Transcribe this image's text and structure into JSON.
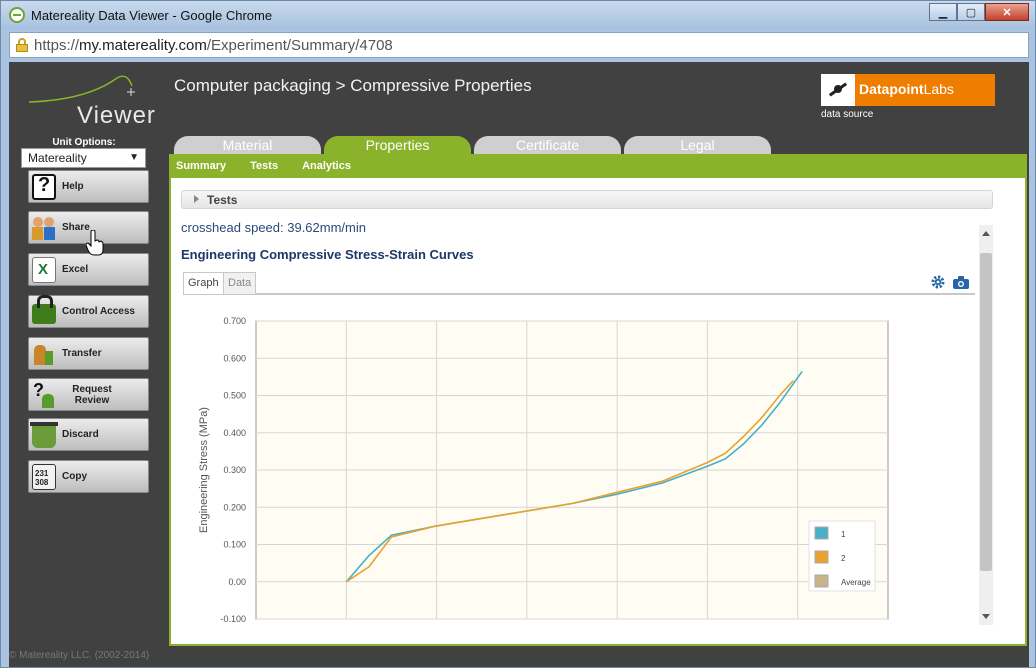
{
  "window": {
    "title": "Matereality Data Viewer - Google Chrome",
    "url_scheme": "https://",
    "url_host": "my.matereality.com",
    "url_path": "/Experiment/Summary/4708"
  },
  "app": {
    "logo_text": "Viewer",
    "breadcrumb": "Computer packaging > Compressive Properties",
    "data_source_name_bold": "Datapoint",
    "data_source_name_rest": "Labs",
    "data_source_caption": "data source",
    "footer": "© Matereality LLC. (2002-2014)"
  },
  "sidebar": {
    "unit_label": "Unit Options:",
    "unit_value": "Matereality",
    "buttons": [
      {
        "label": "Help",
        "icon": "help-icon"
      },
      {
        "label": "Share",
        "icon": "share-icon"
      },
      {
        "label": "Excel",
        "icon": "excel-icon"
      },
      {
        "label": "Control Access",
        "icon": "lock-icon"
      },
      {
        "label": "Transfer",
        "icon": "transfer-icon"
      },
      {
        "label": "Request Review",
        "icon": "request-review-icon"
      },
      {
        "label": "Discard",
        "icon": "discard-icon"
      },
      {
        "label": "Copy",
        "icon": "copy-icon"
      }
    ]
  },
  "tabs": [
    "Material",
    "Properties",
    "Certificate",
    "Legal"
  ],
  "active_tab": "Properties",
  "subnav": [
    "Summary",
    "Tests",
    "Analytics"
  ],
  "panel": {
    "tests_header": "Tests",
    "crosshead_speed": "crosshead speed: 39.62mm/min",
    "chart_title": "Engineering Compressive Stress-Strain Curves",
    "graph_tab": "Graph",
    "data_tab": "Data"
  },
  "colors": {
    "accent_green": "#8ab22a",
    "dark_bg": "#414141",
    "series_1": "#4ab0c6",
    "series_2": "#e9a12f",
    "average": "#c9b38a"
  },
  "chart_data": {
    "type": "line",
    "title": "",
    "xlabel": "",
    "ylabel": "Engineering Stress (MPa)",
    "ylim": [
      -0.1,
      0.7
    ],
    "xlim": [
      0,
      7
    ],
    "yticks": [
      "-0.100",
      "0.00",
      "0.100",
      "0.200",
      "0.300",
      "0.400",
      "0.500",
      "0.600",
      "0.700"
    ],
    "grid": true,
    "legend": "bottom-right",
    "series": [
      {
        "name": "1",
        "x": [
          1.0,
          1.25,
          1.5,
          2.0,
          2.5,
          3.0,
          3.5,
          4.0,
          4.5,
          5.0,
          5.2,
          5.4,
          5.6,
          5.8,
          6.05
        ],
        "y": [
          0.0,
          0.07,
          0.125,
          0.15,
          0.17,
          0.19,
          0.21,
          0.235,
          0.265,
          0.31,
          0.33,
          0.37,
          0.42,
          0.48,
          0.565
        ]
      },
      {
        "name": "2",
        "x": [
          1.0,
          1.25,
          1.5,
          2.0,
          2.5,
          3.0,
          3.5,
          4.0,
          4.5,
          5.0,
          5.2,
          5.4,
          5.6,
          5.8,
          5.95
        ],
        "y": [
          0.0,
          0.04,
          0.12,
          0.15,
          0.17,
          0.19,
          0.21,
          0.24,
          0.27,
          0.32,
          0.345,
          0.39,
          0.44,
          0.5,
          0.54
        ]
      },
      {
        "name": "Average",
        "x": [],
        "y": []
      }
    ]
  }
}
